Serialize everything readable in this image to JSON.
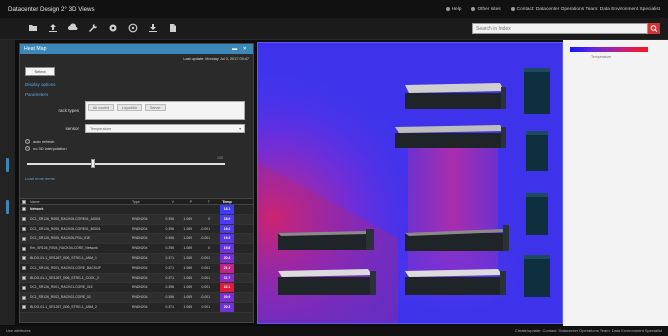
{
  "window": {
    "title": "Datacenter Design 2° 3D Views",
    "links": [
      "Help",
      "Other sites",
      "Contact: Datacenter Operations Team: Data Environment Specialist"
    ]
  },
  "toolbar": {
    "icons": [
      "folder-icon",
      "upload-icon",
      "cloud-icon",
      "wrench-icon",
      "settings-icon",
      "target-icon",
      "download-icon",
      "export-icon"
    ],
    "search_placeholder": "Search in Index"
  },
  "panel": {
    "title": "Heat Map",
    "last_update": "Last update: Monday Jul 3, 2017 03:47",
    "select_button": "Select",
    "display_options": "Display options",
    "parameters": "Parameters",
    "rack_types_label": "rack types",
    "rack_types_tags": [
      "Air cooled",
      "Liquid/Air",
      "Server"
    ],
    "sensor_label": "sensor",
    "sensor_value": "Temperature",
    "radio_auto": "auto refresh",
    "radio_3d": "no 3D interpolation",
    "slider_max": "100",
    "slider_fraction": 0.33,
    "expand_link": "Load more items"
  },
  "table": {
    "headers": [
      "",
      "Name",
      "Type",
      "V",
      "P",
      "T",
      "Temp"
    ],
    "rows": [
      {
        "name": "Network",
        "type": "",
        "v1": "",
        "v2": "",
        "v3": "",
        "temp": "18.1",
        "group": true,
        "color": "#3c3cff"
      },
      {
        "name": "DC1_SR126_R005_RACK05-CORE01_A0001",
        "type": "RNDN204",
        "v1": "0.396",
        "v2": "1.069",
        "v3": "0",
        "temp": "18.9",
        "color": "#4a3cf5"
      },
      {
        "name": "DC1_SR126_R005_RACK05-CORE01_B0001",
        "type": "RNDN204",
        "v1": "0.396",
        "v2": "1.069",
        "v3": "-0.001",
        "temp": "19.2",
        "color": "#5238ef"
      },
      {
        "name": "DC1_SR126_R005_RACK05-PDU_01E",
        "type": "RNDN204",
        "v1": "0.396",
        "v2": "1.069",
        "v3": "-0.001",
        "temp": "19.3",
        "color": "#5a36ea"
      },
      {
        "name": "Rm_SR126_R004_RACK04-CORE_Network",
        "type": "RNDN204",
        "v1": "0.296",
        "v2": "1.069",
        "v3": "0",
        "temp": "19.8",
        "color": "#6a32e0"
      },
      {
        "name": "BLDG-01-1_SR126T_B06_STRG-1_ANM_1",
        "type": "RNDN204",
        "v1": "0.371",
        "v2": "1.065",
        "v3": "-0.001",
        "temp": "20.4",
        "color": "#7a2ed6"
      },
      {
        "name": "DC1_SR126_R003_RACK03-CORE_BACKUP",
        "type": "RNDN204",
        "v1": "0.371",
        "v2": "1.065",
        "v3": "0.001",
        "temp": "21.1",
        "color": "#c02484"
      },
      {
        "name": "BLDG-01-1_SR126T_B06_STRG-1_COOL_2",
        "type": "RNDN204",
        "v1": "0.371",
        "v2": "1.065",
        "v3": "0.001",
        "temp": "21.7",
        "color": "#8a2bcc"
      },
      {
        "name": "DC1_SR126_R001_RACK01-CORE_01E",
        "type": "RNDN204",
        "v1": "0.396",
        "v2": "1.069",
        "v3": "0.001",
        "temp": "22.1",
        "color": "#e01a3a"
      },
      {
        "name": "DC1_SR126_R002_RACK02-CORE_02",
        "type": "RNDN204",
        "v1": "0.396",
        "v2": "1.069",
        "v3": "-0.001",
        "temp": "20.9",
        "color": "#7a2ed6"
      },
      {
        "name": "BLDG-01-1_SR126T_B06_STRG-1_ANM_2",
        "type": "RNDN204",
        "v1": "0.371",
        "v2": "1.065",
        "v3": "0.001",
        "temp": "20.3",
        "color": "#7030dc"
      }
    ]
  },
  "legend": {
    "label": "Temperature",
    "colors": [
      "#1414ff",
      "#6a2ad8",
      "#c22080",
      "#ff1414"
    ]
  },
  "status": {
    "left": "Use attributes",
    "right": "Create/update: Contact: Datacenter Operations Team: Data Environment Specialist"
  }
}
